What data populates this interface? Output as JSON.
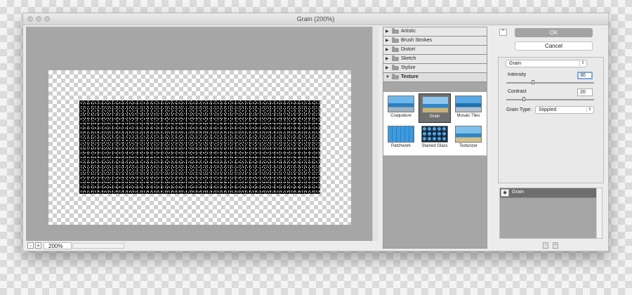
{
  "window": {
    "title": "Grain (200%)"
  },
  "zoom": {
    "minus": "-",
    "plus": "+",
    "value": "200%"
  },
  "categories": [
    {
      "label": "Artistic",
      "open": false
    },
    {
      "label": "Brush Strokes",
      "open": false
    },
    {
      "label": "Distort",
      "open": false
    },
    {
      "label": "Sketch",
      "open": false
    },
    {
      "label": "Stylize",
      "open": false
    },
    {
      "label": "Texture",
      "open": true
    }
  ],
  "arrows": {
    "closed": "▶",
    "open": "▼"
  },
  "thumbnails": [
    {
      "label": "Craquelure",
      "selected": false
    },
    {
      "label": "Grain",
      "selected": true
    },
    {
      "label": "Mosaic Tiles",
      "selected": false
    },
    {
      "label": "Patchwork",
      "selected": false
    },
    {
      "label": "Stained Glass",
      "selected": false
    },
    {
      "label": "Texturizer",
      "selected": false
    }
  ],
  "buttons": {
    "ok": "OK",
    "cancel": "Cancel",
    "collapse": "⌃"
  },
  "settings": {
    "filter_select": "Grain",
    "intensity": {
      "label": "Intensity",
      "value": "30",
      "fraction": 0.3
    },
    "contrast": {
      "label": "Contrast",
      "value": "20",
      "fraction": 0.2
    },
    "grain_type": {
      "label": "Grain Type:",
      "value": "Stippled"
    },
    "select_arrow": "⇕"
  },
  "layers": [
    {
      "label": "Grain",
      "visible": true
    }
  ],
  "icons": {
    "eye": "◉",
    "new_layer": "▫",
    "delete_layer": "▪"
  },
  "colors": {
    "ok_button": "#a3a3a3",
    "active_field": "#7ba7e0",
    "preview_bg": "#a6a6a6"
  }
}
